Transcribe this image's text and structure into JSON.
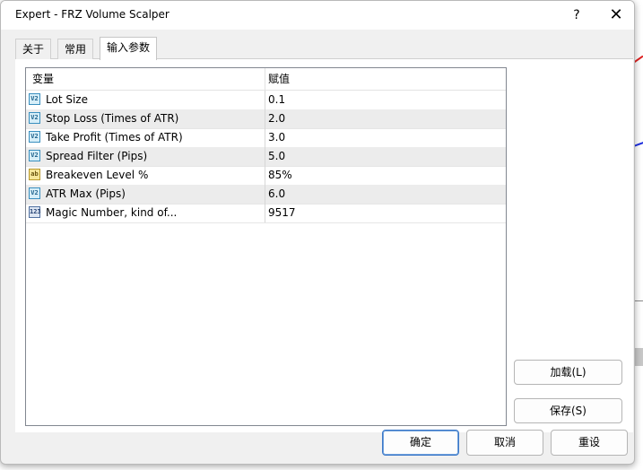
{
  "dialog": {
    "title": "Expert - FRZ Volume Scalper",
    "help_glyph": "?",
    "close_glyph": "✕"
  },
  "tabs": [
    {
      "label": "关于"
    },
    {
      "label": "常用"
    },
    {
      "label": "输入参数",
      "active": true
    }
  ],
  "grid": {
    "headers": {
      "variable": "变量",
      "value": "赋值"
    },
    "rows": [
      {
        "icon": "v2-icon",
        "icon_text": "V2",
        "name": "Lot Size",
        "value": "0.1"
      },
      {
        "icon": "v2-icon",
        "icon_text": "V2",
        "name": "Stop Loss (Times of ATR)",
        "value": "2.0"
      },
      {
        "icon": "v2-icon",
        "icon_text": "V2",
        "name": "Take Profit (Times of ATR)",
        "value": "3.0"
      },
      {
        "icon": "v2-icon",
        "icon_text": "V2",
        "name": "Spread Filter (Pips)",
        "value": "5.0"
      },
      {
        "icon": "ab-icon",
        "icon_text": "ab",
        "name": "Breakeven Level %",
        "value": "85%"
      },
      {
        "icon": "v2-icon",
        "icon_text": "V2",
        "name": "ATR Max (Pips)",
        "value": "6.0"
      },
      {
        "icon": "number-icon",
        "icon_text": "123",
        "name": "Magic Number, kind of...",
        "value": "9517"
      }
    ]
  },
  "buttons": {
    "load": "加载(L)",
    "save": "保存(S)",
    "ok": "确定",
    "cancel": "取消",
    "reset": "重设"
  },
  "colors": {
    "focus_border": "#3c78c8",
    "alt_row": "#ececec",
    "dialog_bg": "#f0f0f0"
  }
}
